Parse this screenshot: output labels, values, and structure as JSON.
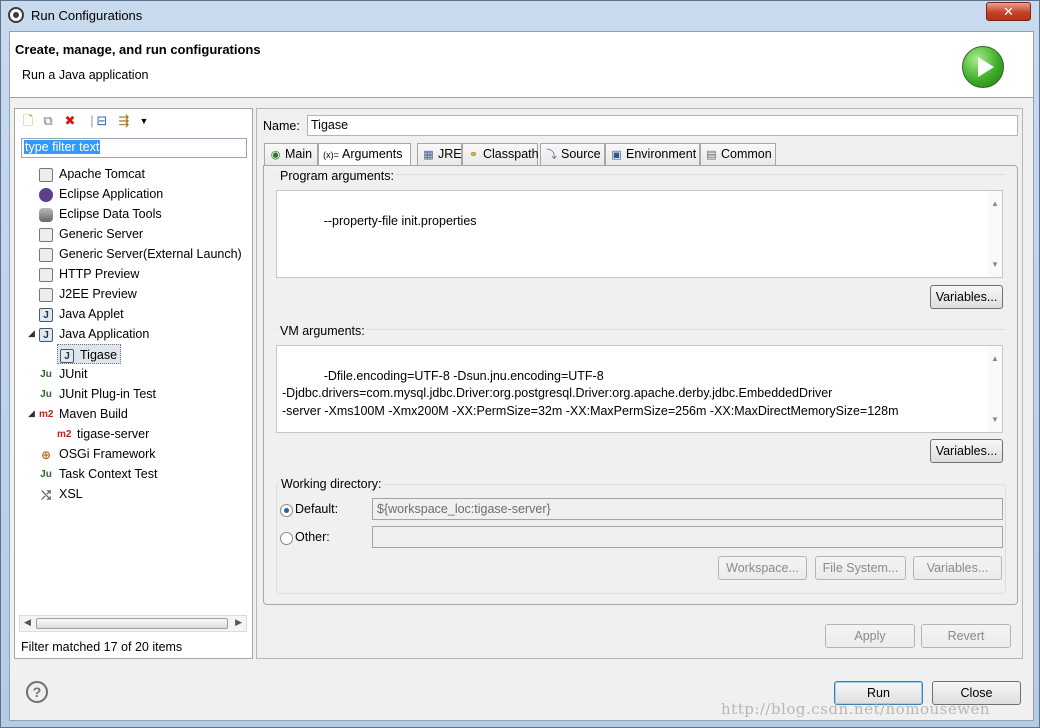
{
  "window": {
    "title": "Run Configurations",
    "close_label": "✕"
  },
  "header": {
    "title": "Create, manage, and run configurations",
    "description": "Run a Java application"
  },
  "left": {
    "filter_text": "type filter text",
    "tree": [
      {
        "label": "Apache Tomcat",
        "icon": "server-icon"
      },
      {
        "label": "Eclipse Application",
        "icon": "eclipse-icon"
      },
      {
        "label": "Eclipse Data Tools",
        "icon": "database-icon"
      },
      {
        "label": "Generic Server",
        "icon": "server-icon"
      },
      {
        "label": "Generic Server(External Launch)",
        "icon": "server-icon"
      },
      {
        "label": "HTTP Preview",
        "icon": "server-icon"
      },
      {
        "label": "J2EE Preview",
        "icon": "server-icon"
      },
      {
        "label": "Java Applet",
        "icon": "java-applet-icon"
      },
      {
        "label": "Java Application",
        "icon": "java-application-icon"
      },
      {
        "label": "Tigase",
        "icon": "java-application-icon"
      },
      {
        "label": "JUnit",
        "icon": "junit-icon"
      },
      {
        "label": "JUnit Plug-in Test",
        "icon": "junit-plugin-icon"
      },
      {
        "label": "Maven Build",
        "icon": "maven-icon"
      },
      {
        "label": "tigase-server",
        "icon": "maven-icon"
      },
      {
        "label": "OSGi Framework",
        "icon": "osgi-icon"
      },
      {
        "label": "Task Context Test",
        "icon": "junit-icon"
      },
      {
        "label": "XSL",
        "icon": "xsl-icon"
      }
    ],
    "status": "Filter matched 17 of 20 items"
  },
  "right": {
    "name_label": "Name:",
    "name_value": "Tigase",
    "tabs": [
      {
        "label": "Main",
        "icon": "main-icon"
      },
      {
        "label": "Arguments",
        "icon": "arguments-icon"
      },
      {
        "label": "JRE",
        "icon": "jre-icon"
      },
      {
        "label": "Classpath",
        "icon": "classpath-icon"
      },
      {
        "label": "Source",
        "icon": "source-icon"
      },
      {
        "label": "Environment",
        "icon": "environment-icon"
      },
      {
        "label": "Common",
        "icon": "common-icon"
      }
    ],
    "program_args_label": "Program arguments:",
    "program_args": "--property-file init.properties",
    "variables_label": "Variables...",
    "vm_args_label": "VM arguments:",
    "vm_args": "-Dfile.encoding=UTF-8 -Dsun.jnu.encoding=UTF-8\n-Djdbc.drivers=com.mysql.jdbc.Driver:org.postgresql.Driver:org.apache.derby.jdbc.EmbeddedDriver\n-server -Xms100M -Xmx200M -XX:PermSize=32m -XX:MaxPermSize=256m -XX:MaxDirectMemorySize=128m",
    "working_dir_label": "Working directory:",
    "default_label": "Default:",
    "default_value": "${workspace_loc:tigase-server}",
    "other_label": "Other:",
    "other_value": "",
    "workspace_label": "Workspace...",
    "filesystem_label": "File System...",
    "variables2_label": "Variables...",
    "apply_label": "Apply",
    "revert_label": "Revert"
  },
  "footer": {
    "help_label": "?",
    "run_label": "Run",
    "close_label": "Close",
    "watermark": "http://blog.csdn.net/homousewen"
  }
}
